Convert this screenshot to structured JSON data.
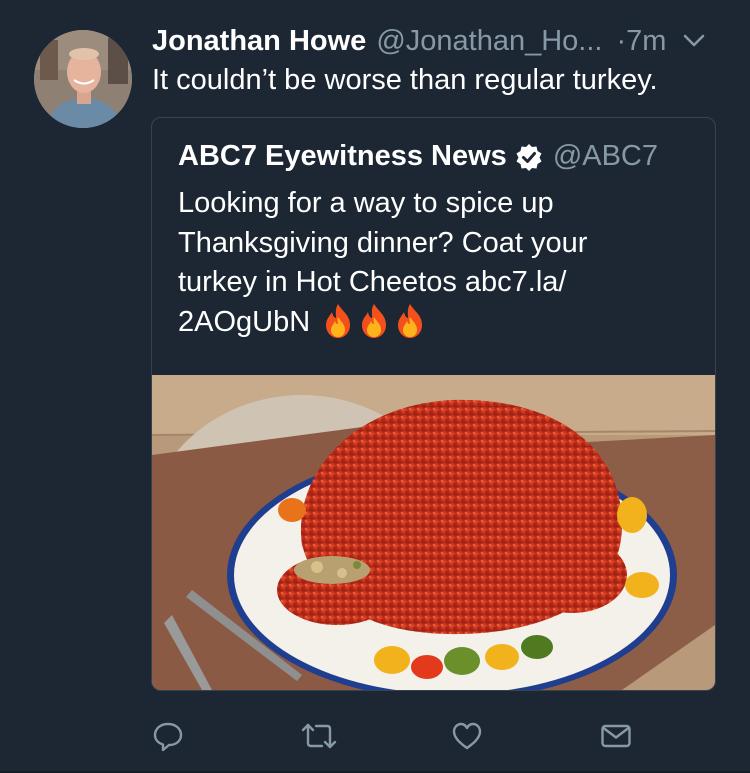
{
  "tweet": {
    "author_name": "Jonathan Howe",
    "author_handle": "@Jonathan_Ho...",
    "time": "·7m",
    "text": "It couldn’t be worse than regular turkey.",
    "avatar_icon": "profile-photo"
  },
  "quoted_tweet": {
    "author_name": "ABC7 Eyewitness News",
    "verified": true,
    "author_handle": "@ABC7",
    "text_lines": [
      "Looking for a way to spice up",
      "Thanksgiving dinner? Coat your",
      "turkey in Hot Cheetos abc7.la/",
      "2AOgUbN"
    ],
    "emojis": [
      "fire",
      "fire",
      "fire"
    ],
    "image_description_icon": "photo"
  },
  "actions": [
    {
      "name": "reply",
      "icon": "speech-bubble-icon"
    },
    {
      "name": "retweet",
      "icon": "retweet-icon"
    },
    {
      "name": "like",
      "icon": "heart-icon"
    },
    {
      "name": "share",
      "icon": "envelope-icon"
    }
  ],
  "colors": {
    "background": "#1c2733",
    "text": "#ffffff",
    "secondary_text": "#8899a6",
    "border": "#38444d",
    "verified": "#ffffff"
  }
}
